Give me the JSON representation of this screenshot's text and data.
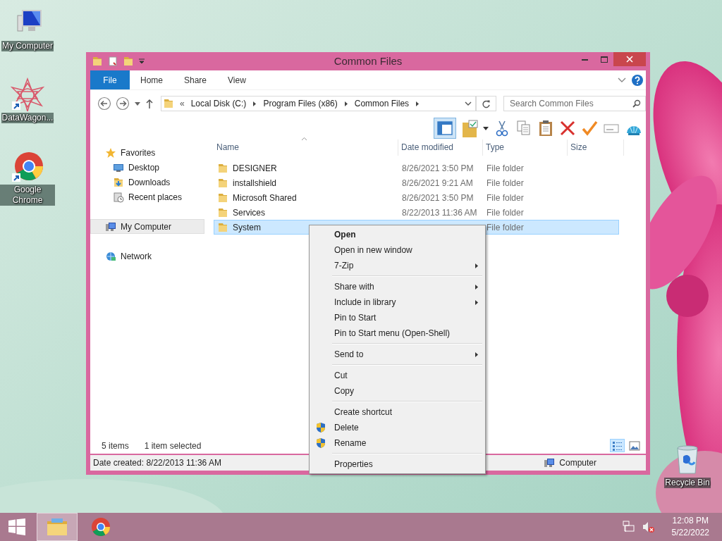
{
  "desktop_icons": [
    {
      "label": "My Computer"
    },
    {
      "label": "DataWagon..."
    },
    {
      "label": "Google Chrome"
    },
    {
      "label": "Recycle Bin"
    }
  ],
  "window": {
    "title": "Common Files",
    "ribbon_tabs": [
      {
        "label": "File",
        "kind": "file"
      },
      {
        "label": "Home",
        "kind": "tab"
      },
      {
        "label": "Share",
        "kind": "tab"
      },
      {
        "label": "View",
        "kind": "tab"
      }
    ],
    "address": {
      "overflow": "«",
      "crumbs": [
        "Local Disk (C:)",
        "Program Files (x86)",
        "Common Files"
      ]
    },
    "search": {
      "placeholder": "Search Common Files"
    },
    "nav": [
      {
        "label": "Favorites",
        "selected": false,
        "children": [
          {
            "label": "Desktop",
            "selected": false
          },
          {
            "label": "Downloads",
            "selected": false
          },
          {
            "label": "Recent places",
            "selected": false
          }
        ]
      },
      {
        "label": "My Computer",
        "selected": true
      },
      {
        "label": "Network",
        "selected": false
      }
    ],
    "columns": [
      "Name",
      "Date modified",
      "Type",
      "Size"
    ],
    "rows": [
      {
        "name": "DESIGNER",
        "date": "8/26/2021 3:50 PM",
        "type": "File folder",
        "selected": false
      },
      {
        "name": "installshield",
        "date": "8/26/2021 9:21 AM",
        "type": "File folder",
        "selected": false
      },
      {
        "name": "Microsoft Shared",
        "date": "8/26/2021 3:50 PM",
        "type": "File folder",
        "selected": false
      },
      {
        "name": "Services",
        "date": "8/22/2013 11:36 AM",
        "type": "File folder",
        "selected": false
      },
      {
        "name": "System",
        "type": "File folder",
        "selected": true
      }
    ],
    "item_count": "5 items",
    "selection_info": "1 item selected",
    "view_buttons": [
      {
        "selected": true
      },
      {
        "selected": false
      }
    ],
    "status_bar": {
      "info": "Date created: 8/22/2013 11:36 AM",
      "location": "Computer"
    }
  },
  "context_menu": [
    {
      "kind": "item",
      "label": "Open",
      "default": true,
      "submenu": false,
      "shield": false
    },
    {
      "kind": "item",
      "label": "Open in new window",
      "default": false,
      "submenu": false,
      "shield": false
    },
    {
      "kind": "item",
      "label": "7-Zip",
      "default": false,
      "submenu": true,
      "shield": false
    },
    {
      "kind": "separator"
    },
    {
      "kind": "item",
      "label": "Share with",
      "default": false,
      "submenu": true,
      "shield": false
    },
    {
      "kind": "item",
      "label": "Include in library",
      "default": false,
      "submenu": true,
      "shield": false
    },
    {
      "kind": "item",
      "label": "Pin to Start",
      "default": false,
      "submenu": false,
      "shield": false
    },
    {
      "kind": "item",
      "label": "Pin to Start menu (Open-Shell)",
      "default": false,
      "submenu": false,
      "shield": false
    },
    {
      "kind": "separator"
    },
    {
      "kind": "item",
      "label": "Send to",
      "default": false,
      "submenu": true,
      "shield": false
    },
    {
      "kind": "separator"
    },
    {
      "kind": "item",
      "label": "Cut",
      "default": false,
      "submenu": false,
      "shield": false
    },
    {
      "kind": "item",
      "label": "Copy",
      "default": false,
      "submenu": false,
      "shield": false
    },
    {
      "kind": "separator"
    },
    {
      "kind": "item",
      "label": "Create shortcut",
      "default": false,
      "submenu": false,
      "shield": false
    },
    {
      "kind": "item",
      "label": "Delete",
      "default": false,
      "submenu": false,
      "shield": true
    },
    {
      "kind": "item",
      "label": "Rename",
      "default": false,
      "submenu": false,
      "shield": true
    },
    {
      "kind": "separator"
    },
    {
      "kind": "item",
      "label": "Properties",
      "default": false,
      "submenu": false,
      "shield": false
    }
  ],
  "taskbar": {
    "apps": [
      {
        "selected": true
      },
      {
        "selected": false
      }
    ],
    "volume_muted": true,
    "time": "12:08 PM",
    "date": "5/22/2022"
  }
}
